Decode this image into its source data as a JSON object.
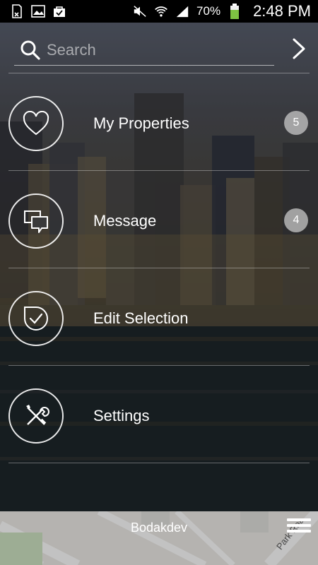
{
  "status_bar": {
    "battery": "70%",
    "time": "2:48 PM"
  },
  "search": {
    "placeholder": "Search"
  },
  "menu": {
    "items": [
      {
        "label": "My Properties",
        "badge": "5"
      },
      {
        "label": "Message",
        "badge": "4"
      },
      {
        "label": "Edit Selection"
      },
      {
        "label": "Settings"
      }
    ]
  },
  "bottom_bar": {
    "location": "Bodakdev",
    "road_label": "Park Roa"
  }
}
